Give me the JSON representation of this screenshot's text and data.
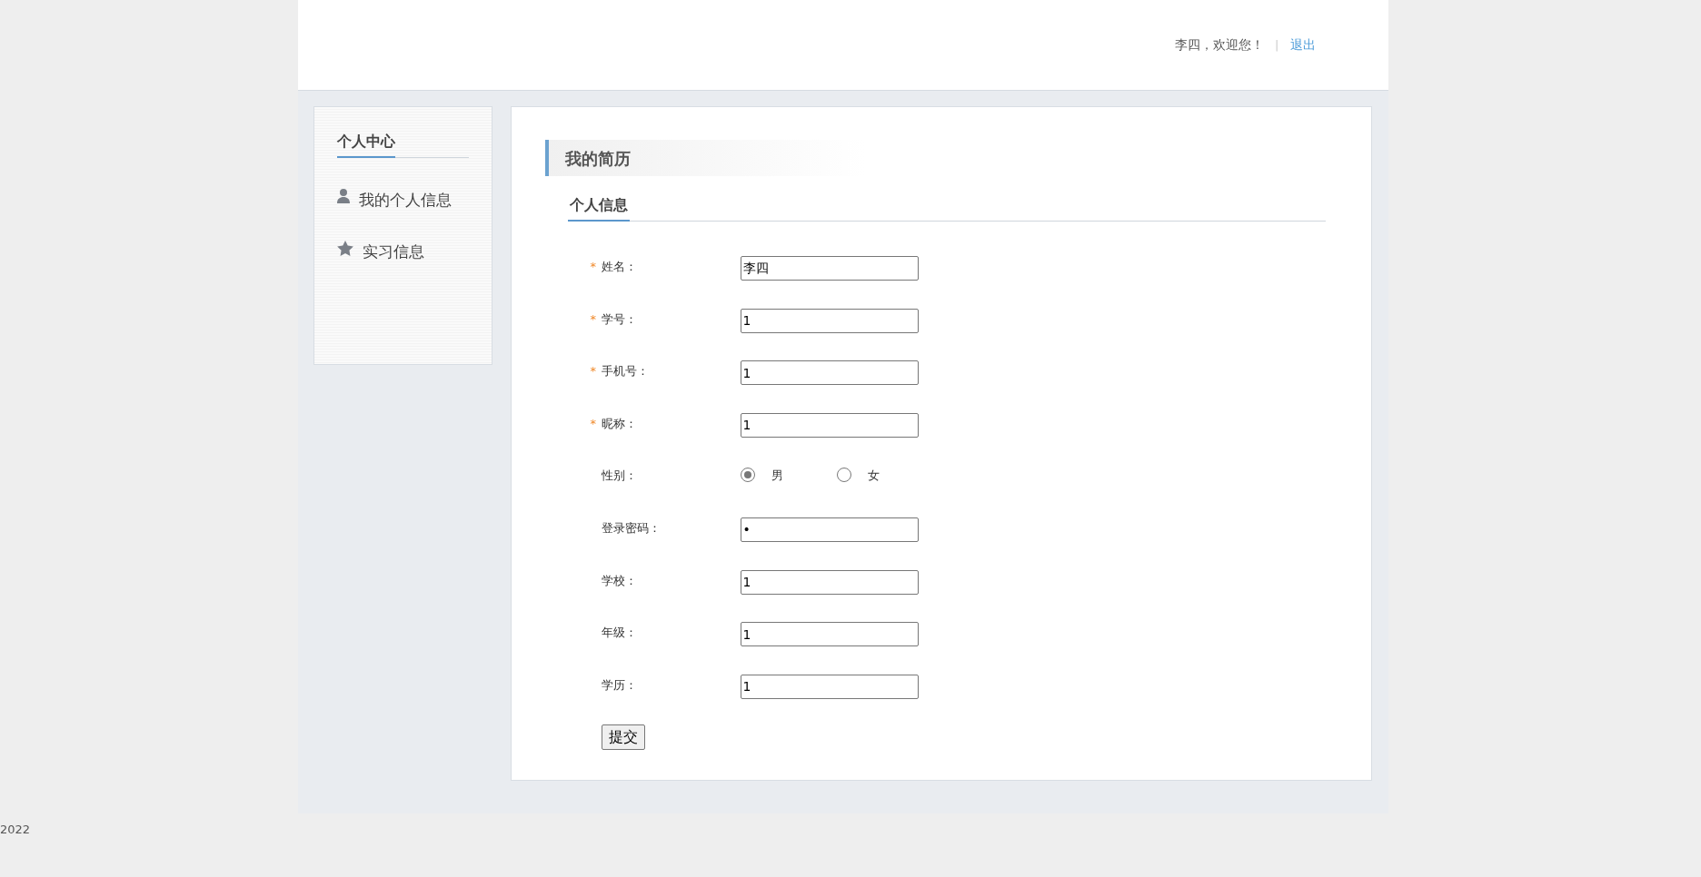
{
  "header": {
    "greeting": "李四，欢迎您！",
    "separator": "|",
    "logout": "退出"
  },
  "sidebar": {
    "title": "个人中心",
    "items": [
      {
        "kind": "person",
        "label": "我的个人信息"
      },
      {
        "kind": "star",
        "label": "实习信息"
      }
    ]
  },
  "main": {
    "section_title": "我的简历",
    "tab_title": "个人信息",
    "fields": [
      {
        "kind": "text",
        "required_mark": "*",
        "label": "姓名：",
        "value": "李四"
      },
      {
        "kind": "text",
        "required_mark": "*",
        "label": "学号：",
        "value": "1"
      },
      {
        "kind": "text",
        "required_mark": "*",
        "label": "手机号：",
        "value": "1"
      },
      {
        "kind": "text",
        "required_mark": "*",
        "label": "昵称：",
        "value": "1"
      },
      {
        "kind": "radio",
        "label": "性别：",
        "options": [
          {
            "label": "男",
            "selected": true
          },
          {
            "label": "女",
            "selected": false
          }
        ]
      },
      {
        "kind": "password",
        "label": "登录密码：",
        "value": "•"
      },
      {
        "kind": "text",
        "label": "学校：",
        "value": "1"
      },
      {
        "kind": "text",
        "label": "年级：",
        "value": "1"
      },
      {
        "kind": "text",
        "label": "学历：",
        "value": "1"
      }
    ],
    "submit": "提交"
  },
  "footer": "2022"
}
